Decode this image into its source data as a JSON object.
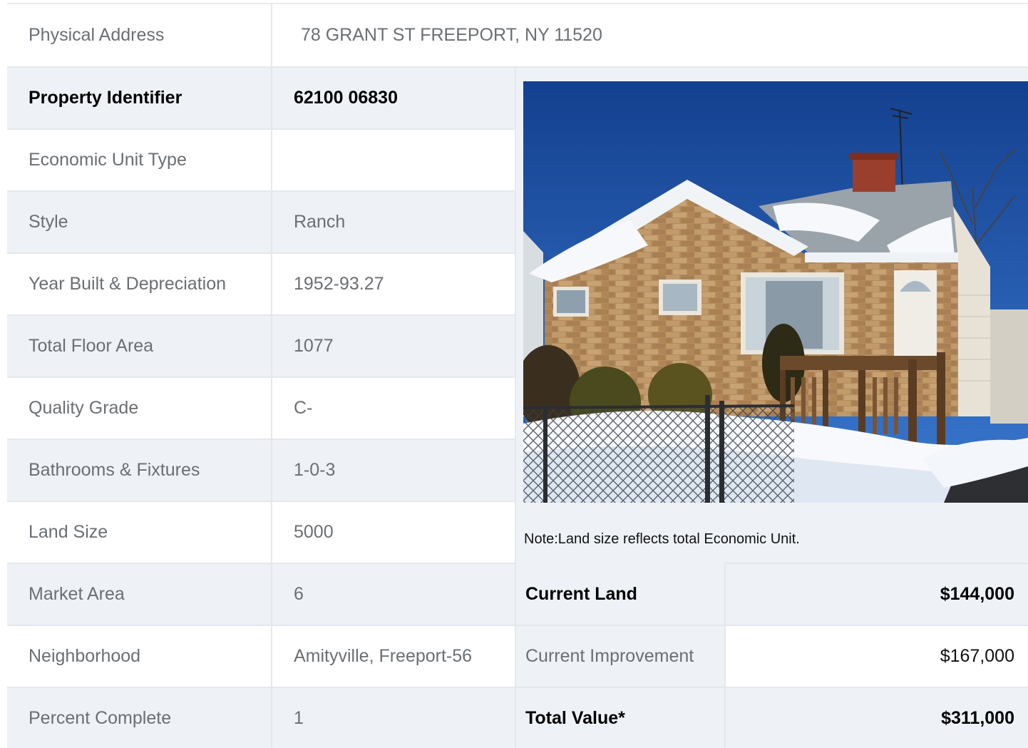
{
  "address": {
    "label": "Physical Address",
    "value": "78  GRANT ST  FREEPORT, NY  11520"
  },
  "property_identifier": {
    "label": "Property Identifier",
    "value": "62100  06830"
  },
  "details": [
    {
      "label": "Economic Unit Type",
      "value": ""
    },
    {
      "label": "Style",
      "value": "Ranch"
    },
    {
      "label": "Year Built & Depreciation",
      "value": "1952-93.27"
    },
    {
      "label": "Total Floor Area",
      "value": "1077"
    },
    {
      "label": "Quality Grade",
      "value": "C-"
    },
    {
      "label": "Bathrooms & Fixtures",
      "value": "1-0-3"
    },
    {
      "label": "Land Size",
      "value": "5000"
    },
    {
      "label": "Market Area",
      "value": "6"
    },
    {
      "label": "Neighborhood",
      "value": "Amityville, Freeport-56"
    },
    {
      "label": "Percent Complete",
      "value": "1"
    }
  ],
  "note": "Note:Land size reflects total Economic Unit.",
  "values": [
    {
      "label": "Current Land",
      "value": "$144,000"
    },
    {
      "label": "Current Improvement",
      "value": "$167,000"
    },
    {
      "label": "Total Value*",
      "value": "$311,000"
    }
  ],
  "photo": {
    "icon": "house-photo"
  }
}
